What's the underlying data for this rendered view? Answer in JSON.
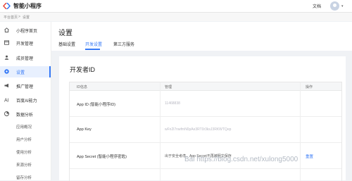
{
  "header": {
    "brand": "智能小程序",
    "doc_link": "文档",
    "caret": "▾"
  },
  "breadcrumb": [
    "平台首页",
    ">",
    "设置"
  ],
  "sidebar": {
    "items": [
      {
        "label": "小程序首页",
        "icon": "home-icon"
      },
      {
        "label": "开发管理",
        "icon": "code-icon"
      },
      {
        "label": "成员管理",
        "icon": "user-icon"
      },
      {
        "label": "设置",
        "icon": "gear-icon"
      },
      {
        "label": "推广管理",
        "icon": "megaphone-icon"
      },
      {
        "label": "百度AI能力",
        "icon": "ai-icon"
      },
      {
        "label": "数据分析",
        "icon": "chart-icon"
      }
    ],
    "sub_items": [
      "应用概况",
      "用户分析",
      "使用分析",
      "来源分析",
      "留存分析"
    ]
  },
  "main": {
    "title": "设置",
    "tabs": [
      "基础设置",
      "开发设置",
      "第三方服务"
    ],
    "active_tab": 1
  },
  "developer": {
    "title": "开发者ID",
    "columns": [
      "ID信息",
      "管理",
      "操作"
    ],
    "rows": [
      {
        "label": "App ID (智能小程序ID)",
        "value": "11468838",
        "action": ""
      },
      {
        "label": "App Key",
        "value": "wFn2l7nwfmN0pAe3RT0r3ksJ3RKWTQep",
        "action": ""
      },
      {
        "label": "App Secret (智能小程序密匙)",
        "value": "出于安全考虑，App Secret不再被明文保存",
        "action": "重置"
      }
    ]
  },
  "watermark": "Bai https://blog.csdn.net/xulong5000",
  "colors": {
    "accent": "#3478f6",
    "background": "#f0f2f5"
  }
}
